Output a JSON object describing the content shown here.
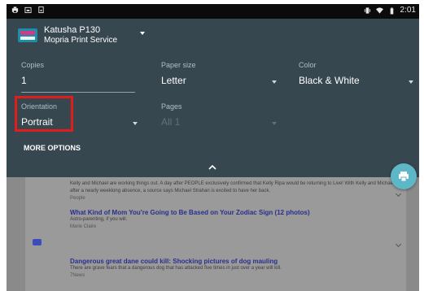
{
  "status_bar": {
    "time": "2:01"
  },
  "printer": {
    "name": "Katusha P130",
    "service": "Mopria Print Service",
    "logo_text": "mopria"
  },
  "options": {
    "copies": {
      "label": "Copies",
      "value": "1"
    },
    "paper_size": {
      "label": "Paper size",
      "value": "Letter"
    },
    "color": {
      "label": "Color",
      "value": "Black & White"
    },
    "orientation": {
      "label": "Orientation",
      "value": "Portrait"
    },
    "pages": {
      "label": "Pages",
      "value": "All 1"
    },
    "more_options": "MORE OPTIONS"
  },
  "preview": {
    "articles": [
      {
        "title": "",
        "body": "Kelly and Michael are working things out. A day after PEOPLE exclusively confirmed that Kelly Ripa would be returning to Live! With Kelly and Michael after a nearly weeklong absence, a source says Michael Strahan is excited to have her back.",
        "source": "People"
      },
      {
        "title": "What Kind of Mom You're Going to Be Based on Your Zodiac Sign (12 photos)",
        "body": "Astro-parenting, if you will.",
        "source": "Marie Claire"
      },
      {
        "title": "Dangerous great dane could kill: Shocking pictures of dog mauling",
        "body": "There are grave fears that a dangerous dog that has attacked five times in just over a year will kill.",
        "source": "7News"
      }
    ]
  },
  "colors": {
    "panel": "#37474f",
    "highlight": "#e01d1d",
    "fab": "#5db7c6",
    "link": "#2a2f8c"
  }
}
